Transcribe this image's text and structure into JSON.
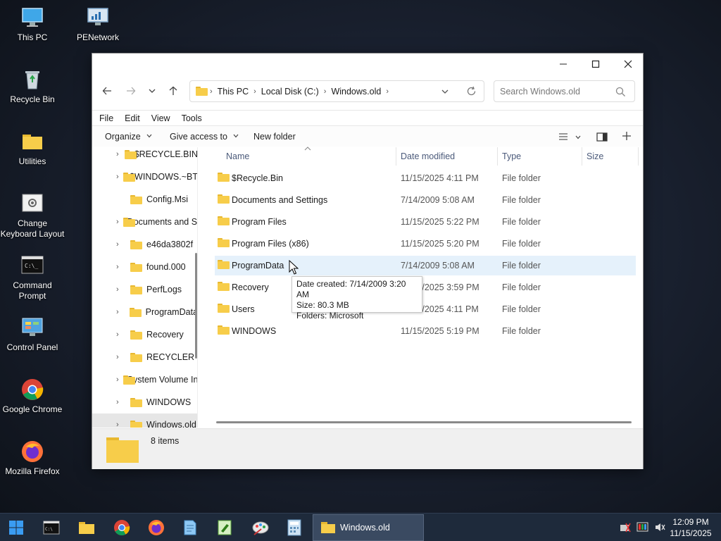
{
  "desktop": {
    "icons": [
      {
        "label": "This PC"
      },
      {
        "label": "PENetwork"
      },
      {
        "label": "Recycle Bin"
      },
      {
        "label": "Utilities"
      },
      {
        "label": "Change Keyboard Layout"
      },
      {
        "label": "Command Prompt"
      },
      {
        "label": "Control Panel"
      },
      {
        "label": "Google Chrome"
      },
      {
        "label": "Mozilla Firefox"
      }
    ]
  },
  "window": {
    "breadcrumb": [
      "This PC",
      "Local Disk (C:)",
      "Windows.old"
    ],
    "search_placeholder": "Search Windows.old",
    "menu": [
      "File",
      "Edit",
      "View",
      "Tools"
    ],
    "toolbar": {
      "organize": "Organize",
      "give_access": "Give access to",
      "new_folder": "New folder"
    },
    "nav_items": [
      {
        "label": "$RECYCLE.BIN",
        "expandable": true
      },
      {
        "label": "$WINDOWS.~BT",
        "expandable": true
      },
      {
        "label": "Config.Msi",
        "expandable": false
      },
      {
        "label": "Documents and Settings",
        "expandable": true
      },
      {
        "label": "e46da3802f",
        "expandable": true
      },
      {
        "label": "found.000",
        "expandable": true
      },
      {
        "label": "PerfLogs",
        "expandable": true
      },
      {
        "label": "ProgramData",
        "expandable": true
      },
      {
        "label": "Recovery",
        "expandable": true
      },
      {
        "label": "RECYCLER",
        "expandable": true
      },
      {
        "label": "System Volume Information",
        "expandable": true
      },
      {
        "label": "WINDOWS",
        "expandable": true
      },
      {
        "label": "Windows.old",
        "expandable": true
      }
    ],
    "columns": {
      "name": "Name",
      "date": "Date modified",
      "type": "Type",
      "size": "Size"
    },
    "files": [
      {
        "name": "$Recycle.Bin",
        "date": "11/15/2025 4:11 PM",
        "type": "File folder"
      },
      {
        "name": "Documents and Settings",
        "date": "7/14/2009 5:08 AM",
        "type": "File folder"
      },
      {
        "name": "Program Files",
        "date": "11/15/2025 5:22 PM",
        "type": "File folder"
      },
      {
        "name": "Program Files (x86)",
        "date": "11/15/2025 5:20 PM",
        "type": "File folder"
      },
      {
        "name": "ProgramData",
        "date": "7/14/2009 5:08 AM",
        "type": "File folder"
      },
      {
        "name": "Recovery",
        "date": "11/15/2025 3:59 PM",
        "type": "File folder"
      },
      {
        "name": "Users",
        "date": "11/15/2025 4:11 PM",
        "type": "File folder"
      },
      {
        "name": "WINDOWS",
        "date": "11/15/2025 5:19 PM",
        "type": "File folder"
      }
    ],
    "tooltip": {
      "line1": "Date created: 7/14/2009 3:20 AM",
      "line2": "Size: 80.3 MB",
      "line3": "Folders: Microsoft"
    },
    "status": {
      "count": "8 items"
    }
  },
  "taskbar": {
    "active_label": "Windows.old",
    "time": "12:09 PM",
    "date": "11/15/2025"
  },
  "colors": {
    "accent": "#0067c0",
    "folder": "#f7cd4a",
    "hover": "#e5f1fb"
  }
}
